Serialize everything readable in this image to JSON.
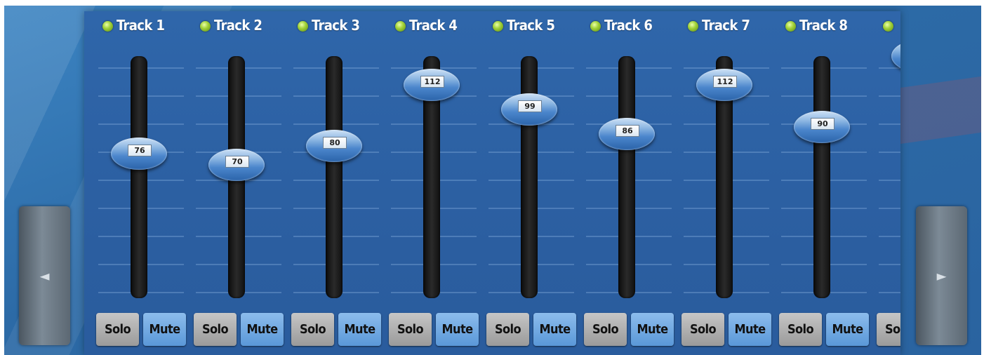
{
  "nav": {
    "left_icon": "◄",
    "right_icon": "►"
  },
  "tracks": [
    {
      "name": "Track 1",
      "value": "76",
      "level": 76
    },
    {
      "name": "Track 2",
      "value": "70",
      "level": 70
    },
    {
      "name": "Track 3",
      "value": "80",
      "level": 80
    },
    {
      "name": "Track 4",
      "value": "112",
      "level": 112
    },
    {
      "name": "Track 5",
      "value": "99",
      "level": 99
    },
    {
      "name": "Track 6",
      "value": "86",
      "level": 86
    },
    {
      "name": "Track 7",
      "value": "112",
      "level": 112
    },
    {
      "name": "Track 8",
      "value": "90",
      "level": 90
    },
    {
      "name": "",
      "value": "",
      "level": 127
    }
  ],
  "fader_max": 127,
  "buttons": {
    "solo_label": "Solo",
    "mute_label": "Mute"
  },
  "colors": {
    "panel": "#2f66aa",
    "led_on": "#a4d33a",
    "mute": "#5a98d8",
    "solo": "#b0b0b0"
  }
}
